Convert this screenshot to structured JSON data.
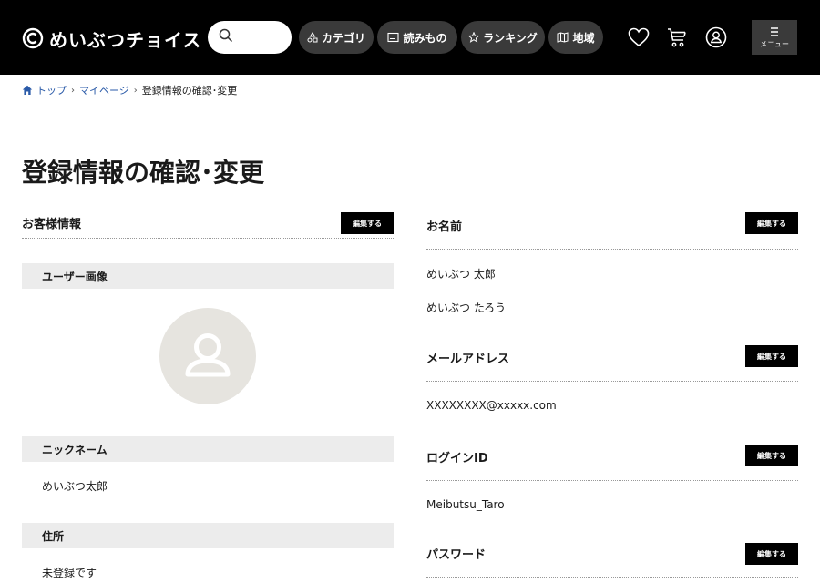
{
  "header": {
    "logo_text": "めいぶつチョイス",
    "search_placeholder": "",
    "nav": {
      "category": "カテゴリ",
      "reading": "読みもの",
      "ranking": "ランキング",
      "area": "地域"
    },
    "menu_label": "メニュー"
  },
  "breadcrumb": {
    "top": "トップ",
    "mypage": "マイページ",
    "current": "登録情報の確認･変更"
  },
  "page_title": "登録情報の確認･変更",
  "left": {
    "section_title": "お客様情報",
    "edit_label": "編集する",
    "user_image_label": "ユーザー画像",
    "nickname_label": "ニックネーム",
    "nickname_value": "めいぶつ太郎",
    "address_label": "住所",
    "address_value": "未登録です"
  },
  "right": {
    "name": {
      "title": "お名前",
      "edit_label": "編集する",
      "value": "めいぶつ 太郎",
      "kana": "めいぶつ たろう"
    },
    "email": {
      "title": "メールアドレス",
      "edit_label": "編集する",
      "value": "XXXXXXXX@xxxxx.com"
    },
    "login": {
      "title": "ログインID",
      "edit_label": "編集する",
      "value": "Meibutsu_Taro"
    },
    "password": {
      "title": "パスワード",
      "edit_label": "編集する"
    }
  }
}
